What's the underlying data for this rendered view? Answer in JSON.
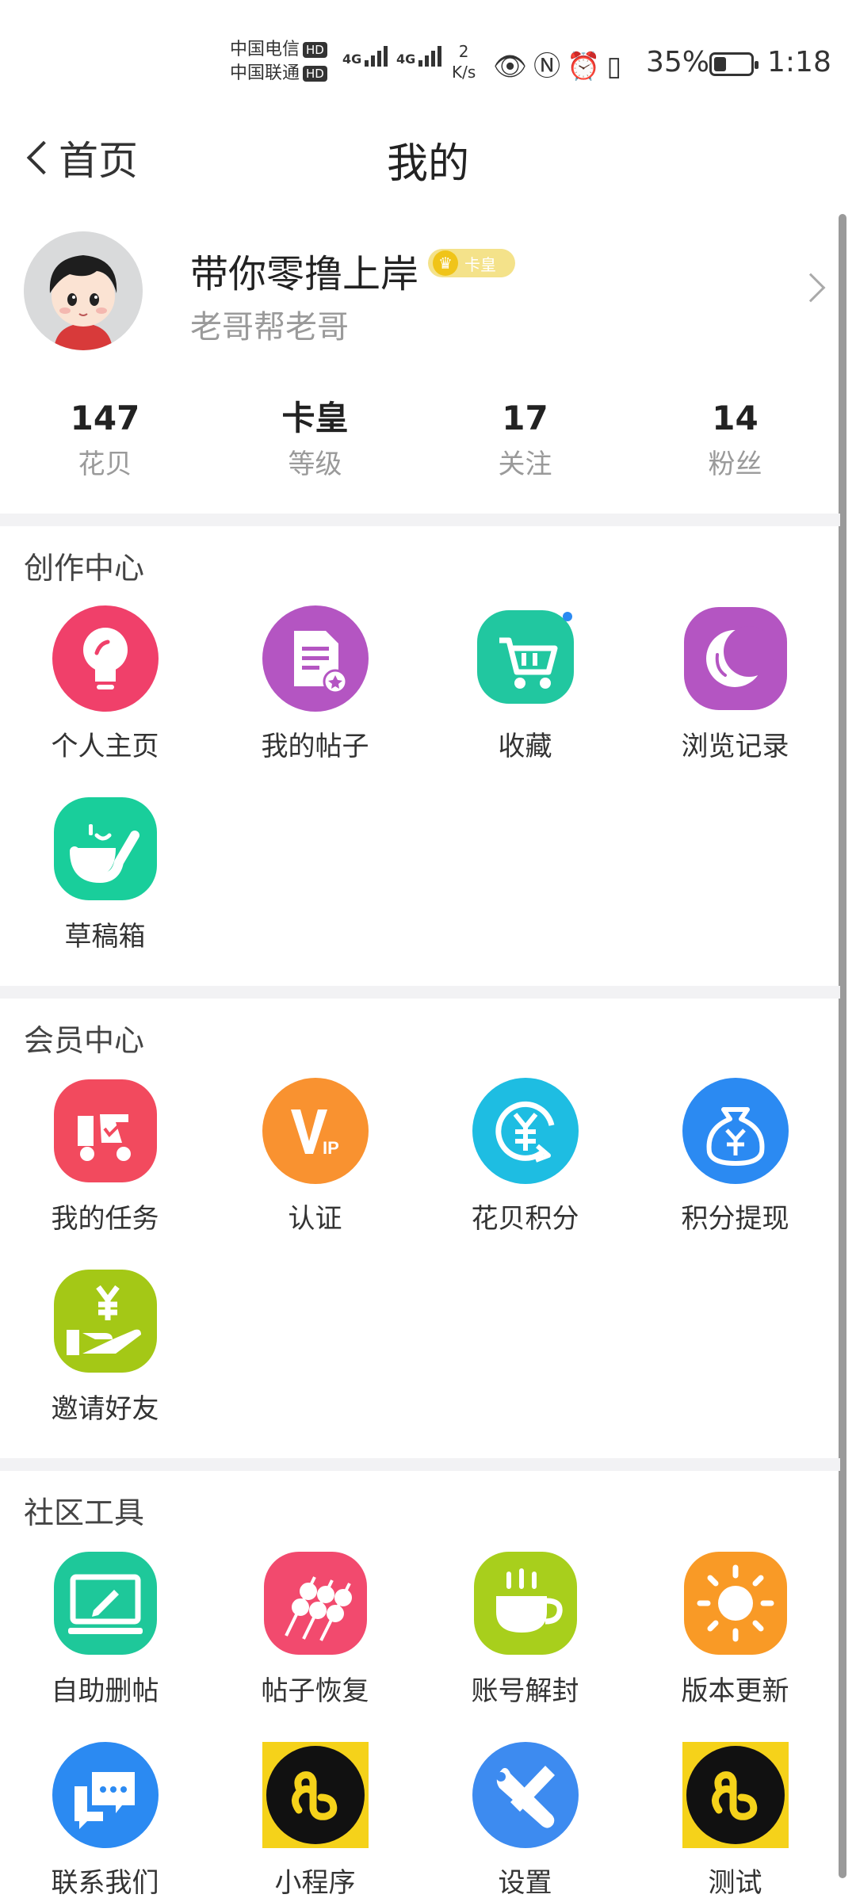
{
  "status_bar": {
    "carrier_1": "中国电信",
    "carrier_2": "中国联通",
    "hd": "HD",
    "network_1": "4G",
    "network_2": "4G",
    "speed_value": "2",
    "speed_unit": "K/s",
    "battery": "35%",
    "battery_level": 0.35,
    "time": "1:18"
  },
  "nav": {
    "back_label": "首页",
    "title": "我的"
  },
  "profile": {
    "username": "带你零撸上岸",
    "badge": "卡皇",
    "signature": "老哥帮老哥"
  },
  "stats": [
    {
      "value": "147",
      "label": "花贝"
    },
    {
      "value": "卡皇",
      "label": "等级"
    },
    {
      "value": "17",
      "label": "关注"
    },
    {
      "value": "14",
      "label": "粉丝"
    }
  ],
  "sections": {
    "creation": {
      "title": "创作中心",
      "items": [
        {
          "label": "个人主页",
          "icon": "lightbulb-icon",
          "color": "#f0406a"
        },
        {
          "label": "我的帖子",
          "icon": "document-star-icon",
          "color": "#b455c2"
        },
        {
          "label": "收藏",
          "icon": "shopping-cart-icon",
          "color": "#21c7a0"
        },
        {
          "label": "浏览记录",
          "icon": "crescent-moon-icon",
          "color": "#b455c2"
        },
        {
          "label": "草稿箱",
          "icon": "pipe-smile-icon",
          "color": "#19ce9b"
        }
      ]
    },
    "membership": {
      "title": "会员中心",
      "items": [
        {
          "label": "我的任务",
          "icon": "scooter-icon",
          "color": "#f24a5e"
        },
        {
          "label": "认证",
          "icon": "vip-icon",
          "color": "#f99230"
        },
        {
          "label": "花贝积分",
          "icon": "yuan-refresh-icon",
          "color": "#1ebde2"
        },
        {
          "label": "积分提现",
          "icon": "money-bag-icon",
          "color": "#2b8af2"
        },
        {
          "label": "邀请好友",
          "icon": "hand-yuan-icon",
          "color": "#a4c816"
        }
      ]
    },
    "tools": {
      "title": "社区工具",
      "items": [
        {
          "label": "自助删帖",
          "icon": "monitor-pen-icon",
          "color": "#1ec89a"
        },
        {
          "label": "帖子恢复",
          "icon": "skewers-icon",
          "color": "#f24a6e"
        },
        {
          "label": "账号解封",
          "icon": "coffee-cup-icon",
          "color": "#a8cf1c"
        },
        {
          "label": "版本更新",
          "icon": "sun-icon",
          "color": "#f99a26"
        },
        {
          "label": "联系我们",
          "icon": "chat-bubbles-icon",
          "color": "#2b8af2"
        },
        {
          "label": "小程序",
          "icon": "mini-program-icon",
          "color": "#f5d21a"
        },
        {
          "label": "设置",
          "icon": "wrench-screwdriver-icon",
          "color": "#3d8bf0"
        },
        {
          "label": "测试",
          "icon": "mini-program-icon",
          "color": "#f5d21a"
        }
      ]
    }
  }
}
